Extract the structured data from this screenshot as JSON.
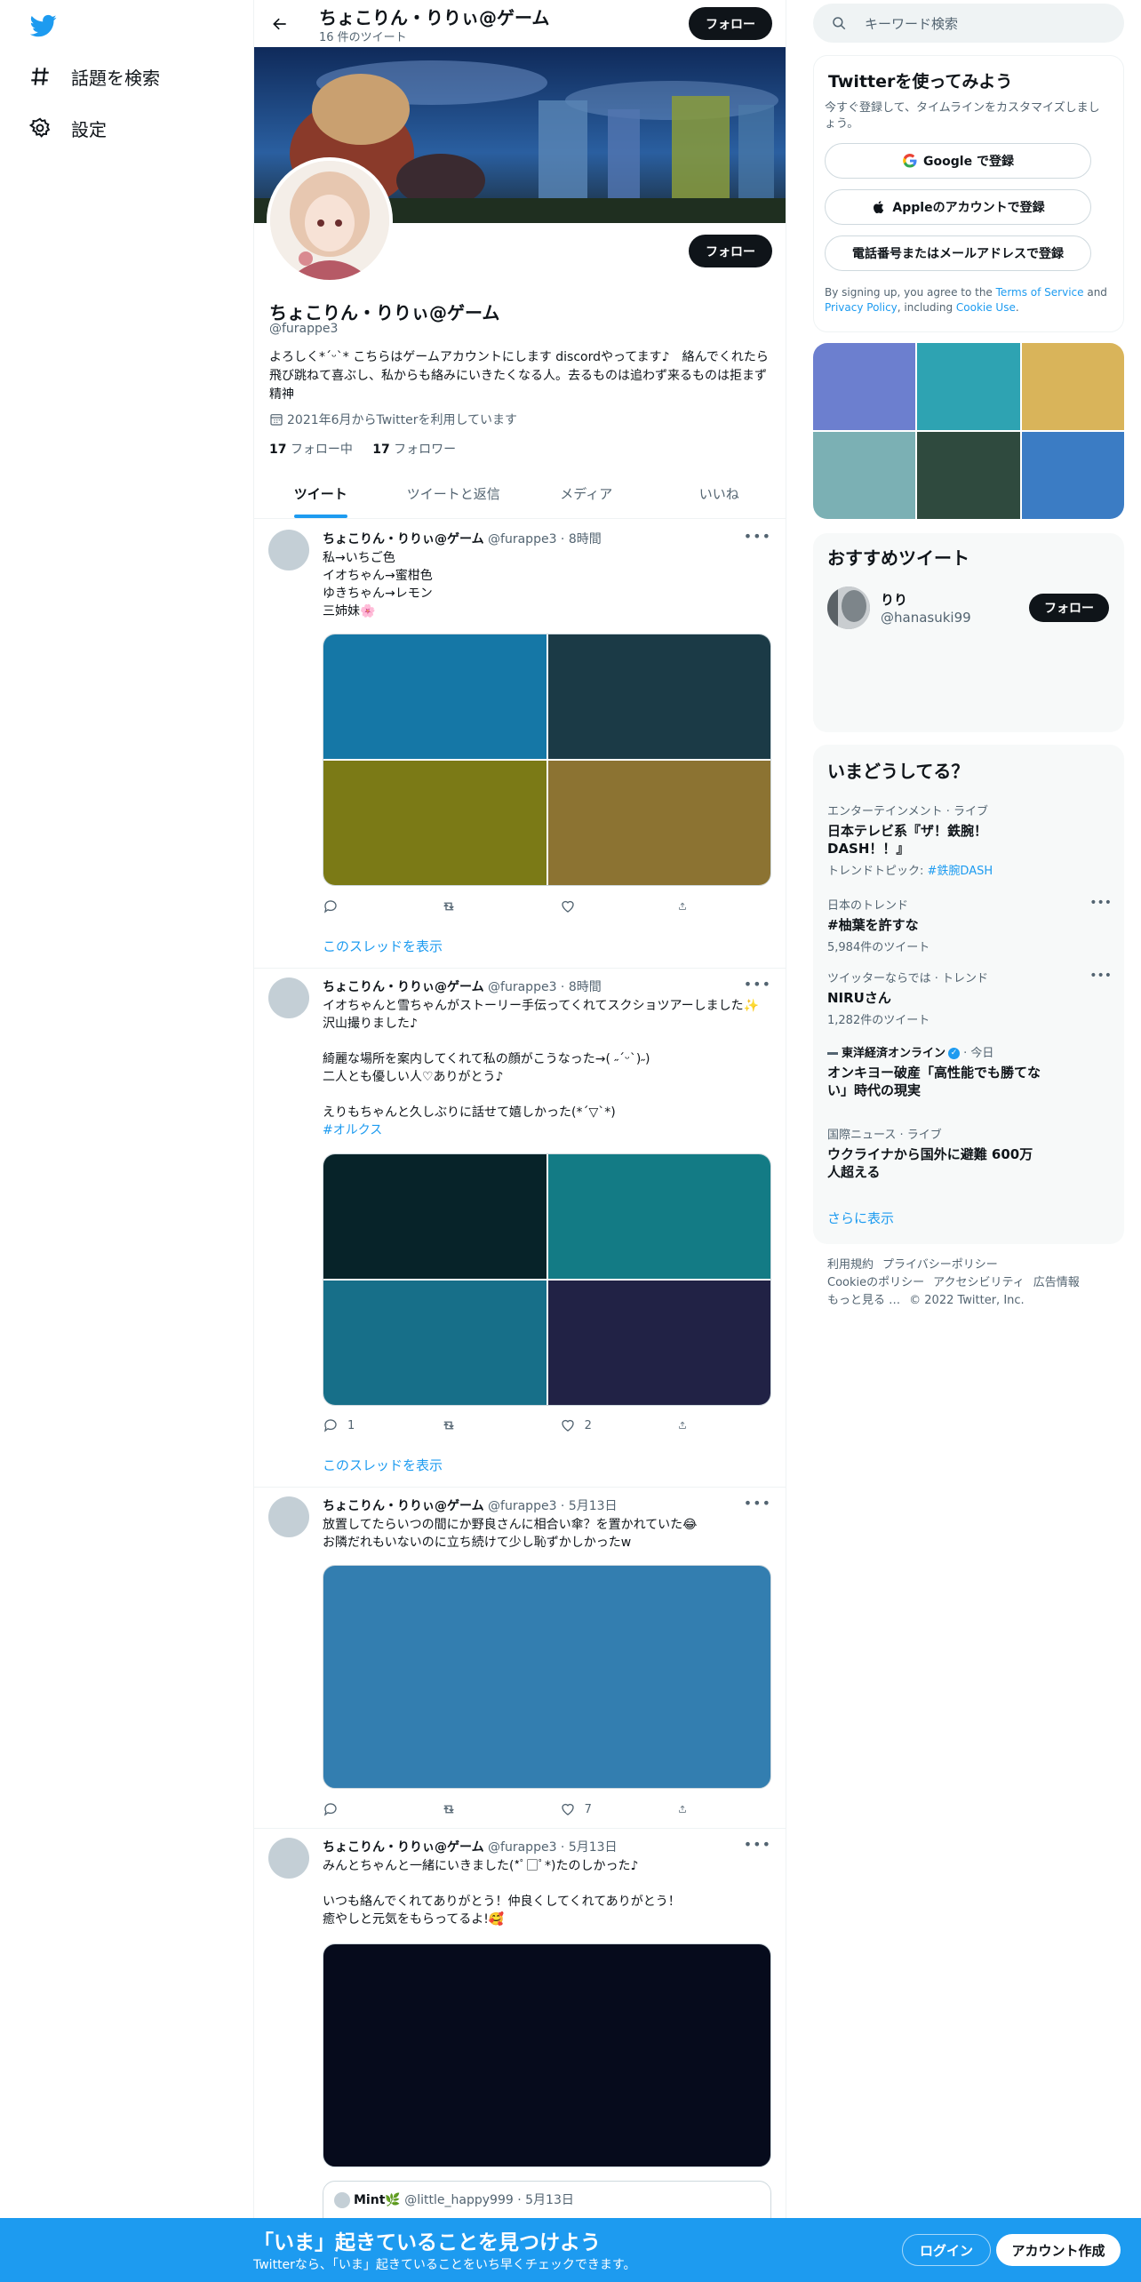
{
  "nav": {
    "explore_label": "話題を検索",
    "settings_label": "設定"
  },
  "profile": {
    "name": "ちょこりん・りりぃ@ゲーム",
    "tweet_count": "16 件のツイート",
    "follow_button": "フォロー",
    "handle": "@furappe3",
    "bio": "よろしく*´ᵕ`* こちらはゲームアカウントにします discordやってます♪　絡んでくれたら飛び跳ねて喜ぶし、私からも絡みにいきたくなる人。去るものは追わず来るものは拒まず精神",
    "joined": "2021年6月からTwitterを利用しています",
    "following_count": "17",
    "following_label": "フォロー中",
    "followers_count": "17",
    "followers_label": "フォロワー"
  },
  "tabs": [
    "ツイート",
    "ツイートと返信",
    "メディア",
    "いいね"
  ],
  "tweets": [
    {
      "name": "ちょこりん・りりぃ@ゲーム",
      "meta": "@furappe3 · 8時間",
      "text": "私→いちご色\nイオちゃん→蜜柑色\nゆきちゃん→レモン\n三姉妹🌸",
      "media_colors": [
        "#1577a6",
        "#1b3a46",
        "#7b7a16",
        "#8c7332"
      ],
      "reply": "",
      "retweet": "",
      "like": "",
      "show_thread": "このスレッドを表示"
    },
    {
      "name": "ちょこりん・りりぃ@ゲーム",
      "meta": "@furappe3 · 8時間",
      "text": "イオちゃんと雪ちゃんがストーリー手伝ってくれてスクショツアーしました✨沢山撮りました♪\n\n綺麗な場所を案内してくれて私の顔がこうなった→( ˶ˊᵕˋ)˶)\n二人とも優しい人♡ありがとう♪\n\nえりもちゃんと久しぶりに話せて嬉しかった(*´▽`*)",
      "hashtag": "#オルクス",
      "media_colors": [
        "#072329",
        "#137b85",
        "#176f89",
        "#212245"
      ],
      "reply": "1",
      "retweet": "",
      "like": "2",
      "show_thread": "このスレッドを表示"
    },
    {
      "name": "ちょこりん・りりぃ@ゲーム",
      "meta": "@furappe3 · 5月13日",
      "text": "放置してたらいつの間にか野良さんに相合い傘？を置かれていた😂\nお隣だれもいないのに立ち続けて少し恥ずかしかったw",
      "media_color": "#337eb0",
      "reply": "",
      "retweet": "",
      "like": "7"
    },
    {
      "name": "ちょこりん・りりぃ@ゲーム",
      "meta": "@furappe3 · 5月13日",
      "text": "みんとちゃんと一緒にいきました(*ﾟ□ﾟ*)たのしかった♪\n\nいつも絡んでくれてありがとう！仲良くしてくれてありがとう！\n癒やしと元気をもらってるよ!🥰",
      "media_color": "#060b1c",
      "quote_name": "Mint🌿",
      "quote_meta": "@little_happy999 · 5月13日"
    }
  ],
  "right": {
    "search_placeholder": "キーワード検索",
    "signup_title": "Twitterを使ってみよう",
    "signup_desc": "今すぐ登録して、タイムラインをカスタマイズしましょう。",
    "google_btn": "Google で登録",
    "apple_btn": "Appleのアカウントで登録",
    "phone_btn": "電話番号またはメールアドレスで登録",
    "terms_prefix": "By signing up, you agree to the ",
    "terms_link": "Terms of Service",
    "terms_and": " and ",
    "privacy_link": "Privacy Policy",
    "terms_including": ", including ",
    "cookie_link": "Cookie Use",
    "terms_end": ".",
    "gallery_colors": [
      "#6c7fcf",
      "#2ea3b2",
      "#d9b45a",
      "#7bb0b4",
      "#2f4a3e",
      "#3b7cc4"
    ],
    "rec_title": "おすすめツイート",
    "rec_name": "りり",
    "rec_handle": "@hanasuki99",
    "rec_follow": "フォロー",
    "trends_title": "いまどうしてる？",
    "trends": [
      {
        "meta": "エンターテインメント · ライブ",
        "title": "日本テレビ系『ザ！鉄腕！DASH！！』",
        "sub_prefix": "トレンドトピック: ",
        "sub_link": "#鉄腕DASH"
      },
      {
        "meta": "日本のトレンド",
        "title": "#柚葉を許すな",
        "sub": "5,984件のツイート"
      },
      {
        "meta": "ツイッターならでは · トレンド",
        "title": "NIRUさん",
        "sub": "1,282件のツイート"
      },
      {
        "meta_source": "東洋経済オンライン",
        "meta_time": " · 今日",
        "title": "オンキヨー破産「高性能でも勝てない」時代の現実"
      },
      {
        "meta": "国際ニュース · ライブ",
        "title": "ウクライナから国外に避難 600万人超える"
      }
    ],
    "show_more": "さらに表示",
    "footer_links": [
      "利用規約",
      "プライバシーポリシー",
      "Cookieのポリシー",
      "アクセシビリティ",
      "広告情報",
      "もっと見る …"
    ],
    "copyright": "© 2022 Twitter, Inc."
  },
  "bottom": {
    "title": "「いま」起きていることを見つけよう",
    "subtitle": "Twitterなら、「いま」起きていることをいち早くチェックできます。",
    "login": "ログイン",
    "signup": "アカウント作成"
  }
}
